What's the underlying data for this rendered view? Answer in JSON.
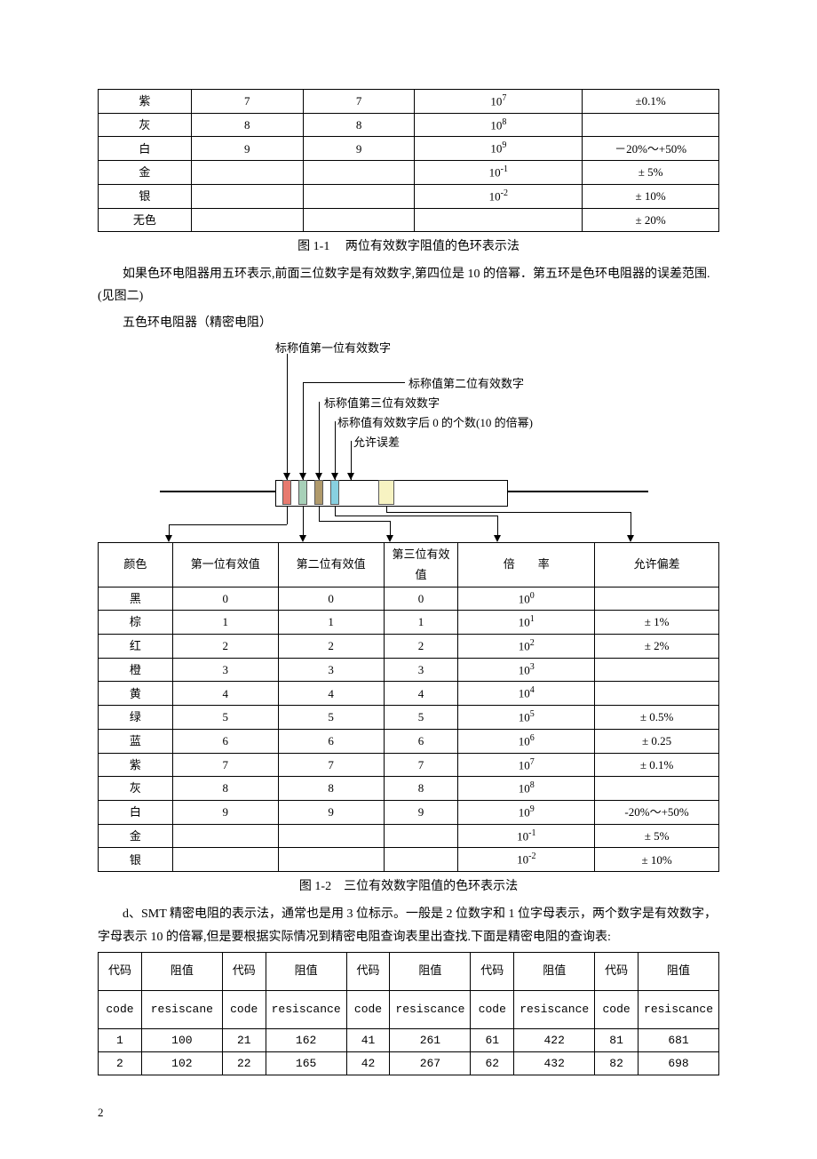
{
  "table1": {
    "rows": [
      {
        "color": "紫",
        "d1": "7",
        "d2": "7",
        "mult": "10<sup>7</sup>",
        "tol": "±0.1%"
      },
      {
        "color": "灰",
        "d1": "8",
        "d2": "8",
        "mult": "10<sup>8</sup>",
        "tol": ""
      },
      {
        "color": "白",
        "d1": "9",
        "d2": "9",
        "mult": "10<sup>9</sup>",
        "tol": "－20%～+50%"
      },
      {
        "color": "金",
        "d1": "",
        "d2": "",
        "mult": "10<sup>-1</sup>",
        "tol": "± 5%"
      },
      {
        "color": "银",
        "d1": "",
        "d2": "",
        "mult": "10<sup>-2</sup>",
        "tol": "± 10%"
      },
      {
        "color": "无色",
        "d1": "",
        "d2": "",
        "mult": "",
        "tol": "± 20%"
      }
    ],
    "caption": "图 1-1　 两位有效数字阻值的色环表示法"
  },
  "para1": "如果色环电阻器用五环表示,前面三位数字是有效数字,第四位是 10 的倍幂．第五环是色环电阻器的误差范围.(见图二)",
  "para2": "五色环电阻器（精密电阻）",
  "diagram": {
    "l1": "标称值第一位有效数字",
    "l2": "标称值第二位有效数字",
    "l3": "标称值第三位有效数字",
    "l4": "标称值有效数字后 0 的个数(10 的倍幂)",
    "l5": "允许误差"
  },
  "table2": {
    "headers": {
      "c0": "颜色",
      "c1": "第一位有效值",
      "c2": "第二位有效值",
      "c3": "第三位有效值",
      "c4": "倍　　率",
      "c5": "允许偏差"
    },
    "rows": [
      {
        "color": "黑",
        "d1": "0",
        "d2": "0",
        "d3": "0",
        "mult": "10<sup>0</sup>",
        "tol": ""
      },
      {
        "color": "棕",
        "d1": "1",
        "d2": "1",
        "d3": "1",
        "mult": "10<sup>1</sup>",
        "tol": "± 1%"
      },
      {
        "color": "红",
        "d1": "2",
        "d2": "2",
        "d3": "2",
        "mult": "10<sup>2</sup>",
        "tol": "± 2%"
      },
      {
        "color": "橙",
        "d1": "3",
        "d2": "3",
        "d3": "3",
        "mult": "10<sup>3</sup>",
        "tol": ""
      },
      {
        "color": "黄",
        "d1": "4",
        "d2": "4",
        "d3": "4",
        "mult": "10<sup>4</sup>",
        "tol": ""
      },
      {
        "color": "绿",
        "d1": "5",
        "d2": "5",
        "d3": "5",
        "mult": "10<sup>5</sup>",
        "tol": "± 0.5%"
      },
      {
        "color": "蓝",
        "d1": "6",
        "d2": "6",
        "d3": "6",
        "mult": "10<sup>6</sup>",
        "tol": "± 0.25"
      },
      {
        "color": "紫",
        "d1": "7",
        "d2": "7",
        "d3": "7",
        "mult": "10<sup>7</sup>",
        "tol": "± 0.1%"
      },
      {
        "color": "灰",
        "d1": "8",
        "d2": "8",
        "d3": "8",
        "mult": "10<sup>8</sup>",
        "tol": ""
      },
      {
        "color": "白",
        "d1": "9",
        "d2": "9",
        "d3": "9",
        "mult": "10<sup>9</sup>",
        "tol": "-20%～+50%"
      },
      {
        "color": "金",
        "d1": "",
        "d2": "",
        "d3": "",
        "mult": "10<sup>-1</sup>",
        "tol": "± 5%"
      },
      {
        "color": "银",
        "d1": "",
        "d2": "",
        "d3": "",
        "mult": "10<sup>-2</sup>",
        "tol": "± 10%"
      }
    ],
    "caption": "图 1-2　三位有效数字阻值的色环表示法"
  },
  "para3": "d、SMT 精密电阻的表示法，通常也是用 3 位标示。一般是 2 位数字和 1 位字母表示，两个数字是有效数字，字母表示 10 的倍幂,但是要根据实际情况到精密电阻查询表里出查找.下面是精密电阻的查询表:",
  "table3": {
    "h1a": "代码",
    "h1b": "阻值",
    "h2a": "code",
    "h2b": "resiscane",
    "h2c": "resiscance",
    "h2d": "resiscance",
    "h2e": "resiscance",
    "h2f": "resiscance",
    "h2cod": "code",
    "h2code": "code",
    "rows": [
      {
        "c": "1",
        "v": "100",
        "c2": "21",
        "v2": "162",
        "c3": "41",
        "v3": "261",
        "c4": "61",
        "v4": "422",
        "c5": "81",
        "v5": "681"
      },
      {
        "c": "2",
        "v": "102",
        "c2": "22",
        "v2": "165",
        "c3": "42",
        "v3": "267",
        "c4": "62",
        "v4": "432",
        "c5": "82",
        "v5": "698"
      }
    ]
  },
  "chart_data": {
    "type": "table",
    "title": "精密电阻查询表(部分)",
    "columns": [
      "代码",
      "阻值",
      "代码",
      "阻值",
      "代码",
      "阻值",
      "代码",
      "阻值",
      "代码",
      "阻值"
    ],
    "rows": [
      [
        "1",
        "100",
        "21",
        "162",
        "41",
        "261",
        "61",
        "422",
        "81",
        "681"
      ],
      [
        "2",
        "102",
        "22",
        "165",
        "42",
        "267",
        "62",
        "432",
        "82",
        "698"
      ]
    ]
  },
  "pageNum": "2"
}
